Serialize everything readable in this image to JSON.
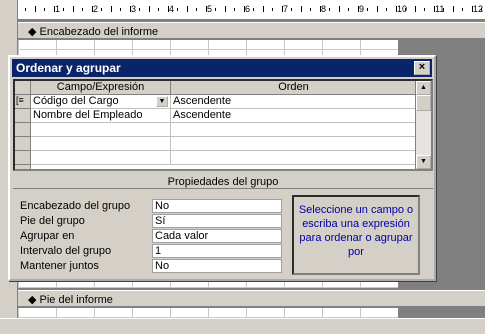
{
  "designer": {
    "ruler_numbers": [
      "1",
      "2",
      "3",
      "4",
      "5",
      "6",
      "7",
      "8",
      "9",
      "10",
      "11",
      "12"
    ],
    "report_header_label": "Encabezado del informe",
    "report_footer_label": "Pie del informe"
  },
  "dialog": {
    "title": "Ordenar y agrupar",
    "close_label": "×",
    "columns": {
      "field": "Campo/Expresión",
      "order": "Orden"
    },
    "rows": [
      {
        "field": "Código del Cargo",
        "order": "Ascendente"
      },
      {
        "field": "Nombre del Empleado",
        "order": "Ascendente"
      }
    ],
    "properties_title": "Propiedades del grupo",
    "properties": [
      {
        "label": "Encabezado del grupo",
        "value": "No"
      },
      {
        "label": "Pie del grupo",
        "value": "Sí"
      },
      {
        "label": "Agrupar en",
        "value": "Cada valor"
      },
      {
        "label": "Intervalo del grupo",
        "value": "1"
      },
      {
        "label": "Mantener juntos",
        "value": "No"
      }
    ],
    "help_text": "Seleccione un campo o escriba una expresión para ordenar o agrupar por"
  },
  "colors": {
    "title_bar": "#0a246a",
    "help_text": "#0000a0",
    "face": "#d4d0c8"
  },
  "icons": {
    "row_selector": "grouping-icon",
    "section": "section-marker-icon"
  }
}
